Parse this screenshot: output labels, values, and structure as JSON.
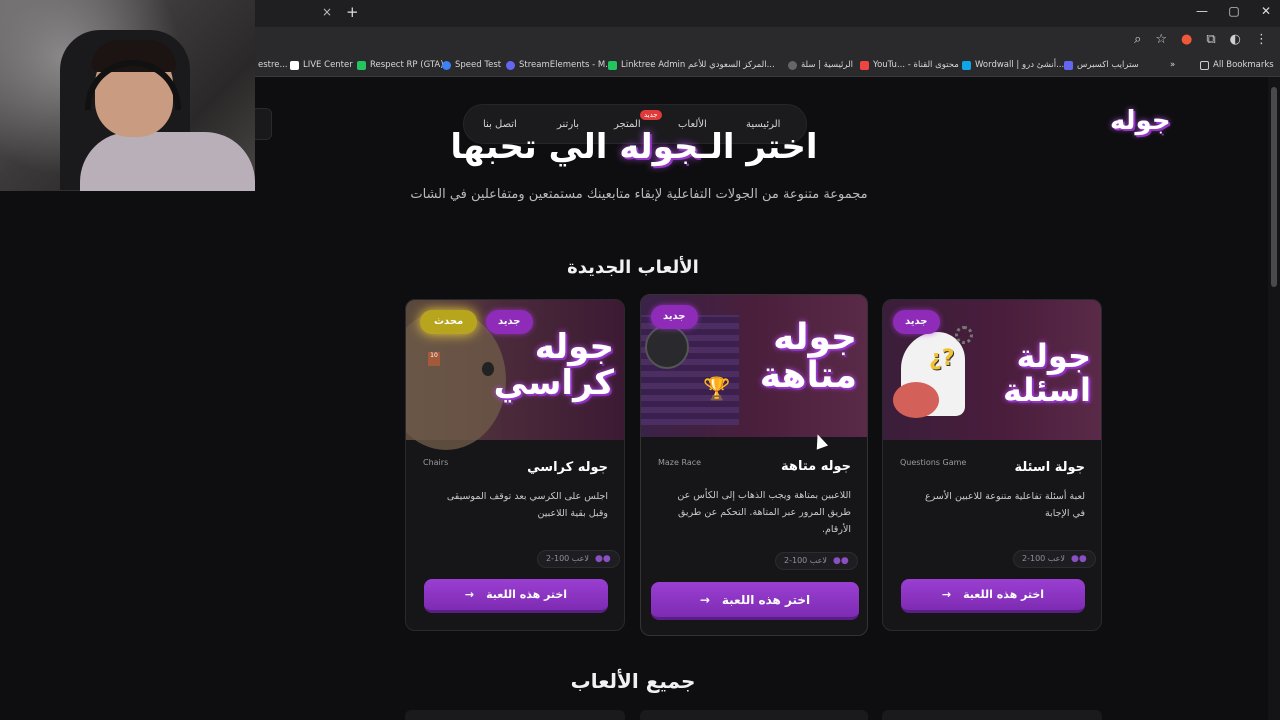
{
  "browser": {
    "tab_close": "×",
    "tab_new": "+",
    "window_controls": [
      "—",
      "▢",
      "✕"
    ],
    "addr_icons": [
      "⌕",
      "☆",
      "●",
      "⧉",
      "◐",
      "⋮"
    ],
    "bookmarks": [
      {
        "label": "estre...",
        "color": "#444"
      },
      {
        "label": "LIVE Center",
        "color": "#ffffff"
      },
      {
        "label": "Respect RP (GTA)",
        "color": "#22c55e"
      },
      {
        "label": "Speed Test",
        "color": "#3b82f6"
      },
      {
        "label": "StreamElements - M...",
        "color": "#6366f1"
      },
      {
        "label": "Linktree Admin",
        "color": "#22c55e"
      },
      {
        "label": "المركز السعودي للأعم...",
        "color": "#aaaaaa"
      },
      {
        "label": "الرئيسية | سلة",
        "color": "#cccccc"
      },
      {
        "label": "YouTu... - محتوى القناة",
        "color": "#ef4444"
      },
      {
        "label": "Wordwall | أنشئ درو...",
        "color": "#0ea5e9"
      },
      {
        "label": "سترايب اكسبرس",
        "color": "#6366f1"
      },
      {
        "label": "»",
        "color": ""
      },
      {
        "label": "All Bookmarks",
        "color": ""
      }
    ]
  },
  "site": {
    "logo": "جوله",
    "nav": {
      "home": "الرئيسية",
      "games": "الألعاب",
      "store": "المتجر",
      "store_badge": "جديد",
      "partner": "بارتنر",
      "contact": "اتصل بنا"
    },
    "hero": {
      "title_part1": "اختر الـ",
      "title_accent": "جوله",
      "title_part2": "الي تحبها",
      "subtitle": "مجموعة متنوعة من الجولات التفاعلية لإبقاء متابعينك مستمتعين ومتفاعلين في الشات"
    },
    "new_games_title": "الألعاب الجديدة",
    "all_games_title": "جميع الألعاب",
    "cards": [
      {
        "art_line1": "جوله",
        "art_line2": "كراسي",
        "badge_new": "جديد",
        "badge_updated": "محدث",
        "name": "جوله كراسي",
        "en": "Chairs",
        "desc_line1": "اجلس على الكرسي بعد توقف الموسيقى",
        "desc_line2": "وقبل بقية اللاعبين",
        "players": "2-100 لاعب",
        "button": "اختر هذه اللعبة",
        "arrow": "→"
      },
      {
        "art_line1": "جوله",
        "art_line2": "متاهة",
        "badge_new": "جديد",
        "name": "جوله متاهة",
        "en": "Maze Race",
        "desc_line1": "اللاعبين بمتاهة ويجب الذهاب إلى الكأس عن",
        "desc_line2": "طريق المرور عبر المتاهة. التحكم عن طريق",
        "desc_line3": "الأرقام.",
        "players": "2-100 لاعب",
        "button": "اختر هذه اللعبة",
        "arrow": "→"
      },
      {
        "art_line1": "جولة",
        "art_line2": "اسئلة",
        "badge_new": "جديد",
        "name": "جولة اسئلة",
        "en": "Questions Game",
        "desc_line1": "لعبة أسئلة تفاعلية متنوعة للاعبين الأسرع",
        "desc_line2": "في الإجابة",
        "players": "2-100 لاعب",
        "button": "اختر هذه اللعبة",
        "arrow": "→"
      }
    ],
    "chairs_art_number": "10",
    "questions_art_symbol": "¿?",
    "maze_art_trophy": "🏆"
  },
  "colors": {
    "accent": "#8e2bb8",
    "updated": "#b8a51e",
    "badge_red": "#e03a3a"
  }
}
